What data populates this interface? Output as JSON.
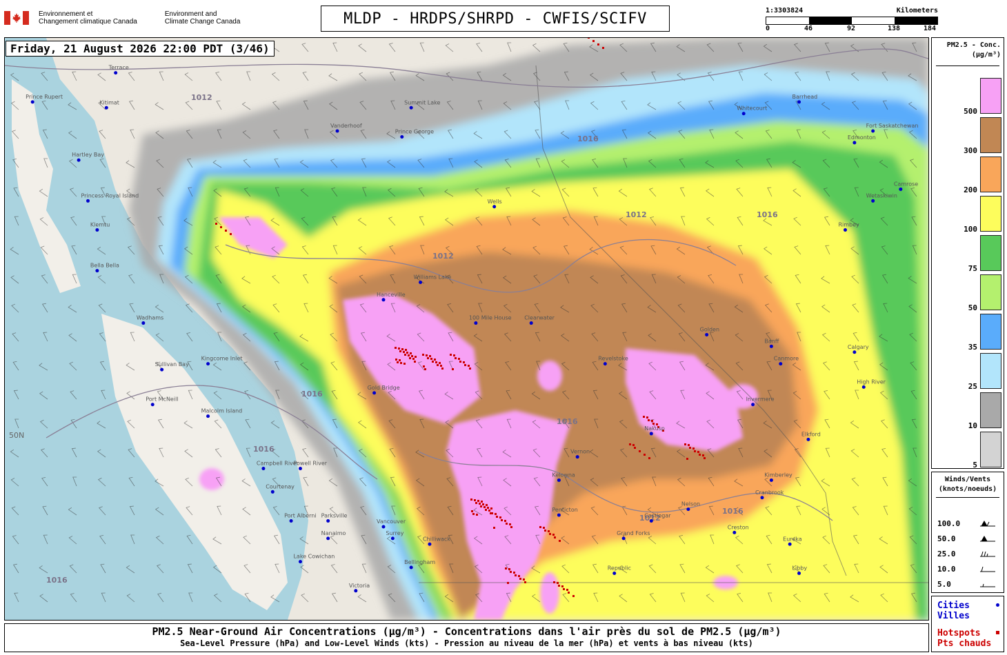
{
  "header": {
    "department_fr": [
      "Environnement et",
      "Changement climatique Canada"
    ],
    "department_en": [
      "Environment and",
      "Climate Change Canada"
    ],
    "title": "MLDP - HRDPS/SHRPD - CWFIS/SCIFV"
  },
  "scale": {
    "ratio": "1:3303824",
    "unit": "Kilometers",
    "ticks": [
      "0",
      "46",
      "92",
      "138",
      "184"
    ]
  },
  "timestamp": "Friday, 21 August 2026 22:00 PDT (3/46)",
  "legend": {
    "title_line1": "PM2.5 - Conc.",
    "title_line2": "(µg/m³)",
    "levels": [
      {
        "label": "500",
        "color": "#f7a1f5"
      },
      {
        "label": "300",
        "color": "#c18754"
      },
      {
        "label": "200",
        "color": "#f9a65a"
      },
      {
        "label": "100",
        "color": "#fdfd5c"
      },
      {
        "label": "75",
        "color": "#58c95a"
      },
      {
        "label": "50",
        "color": "#b4f06e"
      },
      {
        "label": "35",
        "color": "#5aacfb"
      },
      {
        "label": "25",
        "color": "#b2e5fb"
      },
      {
        "label": "10",
        "color": "#a9a9a9"
      },
      {
        "label": "5",
        "color": "#d3d3d3"
      }
    ]
  },
  "winds": {
    "title_line1": "Winds/Vents",
    "title_line2": "(knots/noeuds)",
    "speeds": [
      "100.0",
      "50.0",
      "25.0",
      "10.0",
      "5.0"
    ]
  },
  "key": {
    "cities": [
      "Cities",
      "Villes"
    ],
    "hotspots": [
      "Hotspots",
      "Pts chauds"
    ]
  },
  "caption": {
    "line1": "PM2.5 Near-Ground Air Concentrations (µg/m³) - Concentrations dans l'air près du sol de PM2.5 (µg/m³)",
    "line2": "Sea-Level Pressure (hPa) and Low-Level Winds (kts) - Pression au niveau de la mer (hPa) et vents à bas niveau (kts)"
  },
  "map": {
    "latitude_label": "50N",
    "isobar_labels": [
      "1012",
      "1016"
    ],
    "cities": [
      {
        "name": "Prince Rupert",
        "lon": 0.03,
        "lat": 0.11
      },
      {
        "name": "Terrace",
        "lon": 0.12,
        "lat": 0.06
      },
      {
        "name": "Kitimat",
        "lon": 0.11,
        "lat": 0.12
      },
      {
        "name": "Hartley Bay",
        "lon": 0.08,
        "lat": 0.21
      },
      {
        "name": "Princess Royal Island",
        "lon": 0.09,
        "lat": 0.28
      },
      {
        "name": "Klemtu",
        "lon": 0.1,
        "lat": 0.33
      },
      {
        "name": "Bella Bella",
        "lon": 0.1,
        "lat": 0.4
      },
      {
        "name": "Vanderhoof",
        "lon": 0.36,
        "lat": 0.16
      },
      {
        "name": "Prince George",
        "lon": 0.43,
        "lat": 0.17
      },
      {
        "name": "Summit Lake",
        "lon": 0.44,
        "lat": 0.12
      },
      {
        "name": "Hanceville",
        "lon": 0.41,
        "lat": 0.45
      },
      {
        "name": "Williams Lake",
        "lon": 0.45,
        "lat": 0.42
      },
      {
        "name": "100 Mile House",
        "lon": 0.51,
        "lat": 0.49
      },
      {
        "name": "Clearwater",
        "lon": 0.57,
        "lat": 0.49
      },
      {
        "name": "Gold Bridge",
        "lon": 0.4,
        "lat": 0.61
      },
      {
        "name": "Revelstoke",
        "lon": 0.65,
        "lat": 0.56
      },
      {
        "name": "Golden",
        "lon": 0.76,
        "lat": 0.51
      },
      {
        "name": "Canmore",
        "lon": 0.84,
        "lat": 0.56
      },
      {
        "name": "Invermere",
        "lon": 0.81,
        "lat": 0.63
      },
      {
        "name": "Nakusp",
        "lon": 0.7,
        "lat": 0.68
      },
      {
        "name": "Kelowna",
        "lon": 0.6,
        "lat": 0.76
      },
      {
        "name": "Penticton",
        "lon": 0.6,
        "lat": 0.82
      },
      {
        "name": "Vernon",
        "lon": 0.62,
        "lat": 0.72
      },
      {
        "name": "Castlegar",
        "lon": 0.7,
        "lat": 0.83
      },
      {
        "name": "Nelson",
        "lon": 0.74,
        "lat": 0.81
      },
      {
        "name": "Cranbrook",
        "lon": 0.82,
        "lat": 0.79
      },
      {
        "name": "Creston",
        "lon": 0.79,
        "lat": 0.85
      },
      {
        "name": "Grand Forks",
        "lon": 0.67,
        "lat": 0.86
      },
      {
        "name": "Republic",
        "lon": 0.66,
        "lat": 0.92
      },
      {
        "name": "Elkford",
        "lon": 0.87,
        "lat": 0.69
      },
      {
        "name": "Calgary",
        "lon": 0.92,
        "lat": 0.54
      },
      {
        "name": "High River",
        "lon": 0.93,
        "lat": 0.6
      },
      {
        "name": "Banff",
        "lon": 0.83,
        "lat": 0.53
      },
      {
        "name": "Edmonton",
        "lon": 0.92,
        "lat": 0.18
      },
      {
        "name": "Whitecourt",
        "lon": 0.8,
        "lat": 0.13
      },
      {
        "name": "Barrhead",
        "lon": 0.86,
        "lat": 0.11
      },
      {
        "name": "Fort Saskatchewan",
        "lon": 0.94,
        "lat": 0.16
      },
      {
        "name": "Camrose",
        "lon": 0.97,
        "lat": 0.26
      },
      {
        "name": "Wetaskiwin",
        "lon": 0.94,
        "lat": 0.28
      },
      {
        "name": "Rimbey",
        "lon": 0.91,
        "lat": 0.33
      },
      {
        "name": "Sullivan Bay",
        "lon": 0.17,
        "lat": 0.57
      },
      {
        "name": "Kingcome Inlet",
        "lon": 0.22,
        "lat": 0.56
      },
      {
        "name": "Wadhams",
        "lon": 0.15,
        "lat": 0.49
      },
      {
        "name": "Port McNeill",
        "lon": 0.16,
        "lat": 0.63
      },
      {
        "name": "Malcolm Island",
        "lon": 0.22,
        "lat": 0.65
      },
      {
        "name": "Campbell River",
        "lon": 0.28,
        "lat": 0.74
      },
      {
        "name": "Powell River",
        "lon": 0.32,
        "lat": 0.74
      },
      {
        "name": "Courtenay",
        "lon": 0.29,
        "lat": 0.78
      },
      {
        "name": "Port Alberni",
        "lon": 0.31,
        "lat": 0.83
      },
      {
        "name": "Parksville",
        "lon": 0.35,
        "lat": 0.83
      },
      {
        "name": "Nanaimo",
        "lon": 0.35,
        "lat": 0.86
      },
      {
        "name": "Lake Cowichan",
        "lon": 0.32,
        "lat": 0.9
      },
      {
        "name": "Vancouver",
        "lon": 0.41,
        "lat": 0.84
      },
      {
        "name": "Surrey",
        "lon": 0.42,
        "lat": 0.86
      },
      {
        "name": "Chilliwack",
        "lon": 0.46,
        "lat": 0.87
      },
      {
        "name": "Bellingham",
        "lon": 0.44,
        "lat": 0.91
      },
      {
        "name": "Victoria",
        "lon": 0.38,
        "lat": 0.95
      },
      {
        "name": "Eureka",
        "lon": 0.85,
        "lat": 0.87
      },
      {
        "name": "Libby",
        "lon": 0.86,
        "lat": 0.92
      },
      {
        "name": "Kimberley",
        "lon": 0.83,
        "lat": 0.76
      },
      {
        "name": "Wells",
        "lon": 0.53,
        "lat": 0.29
      }
    ]
  }
}
